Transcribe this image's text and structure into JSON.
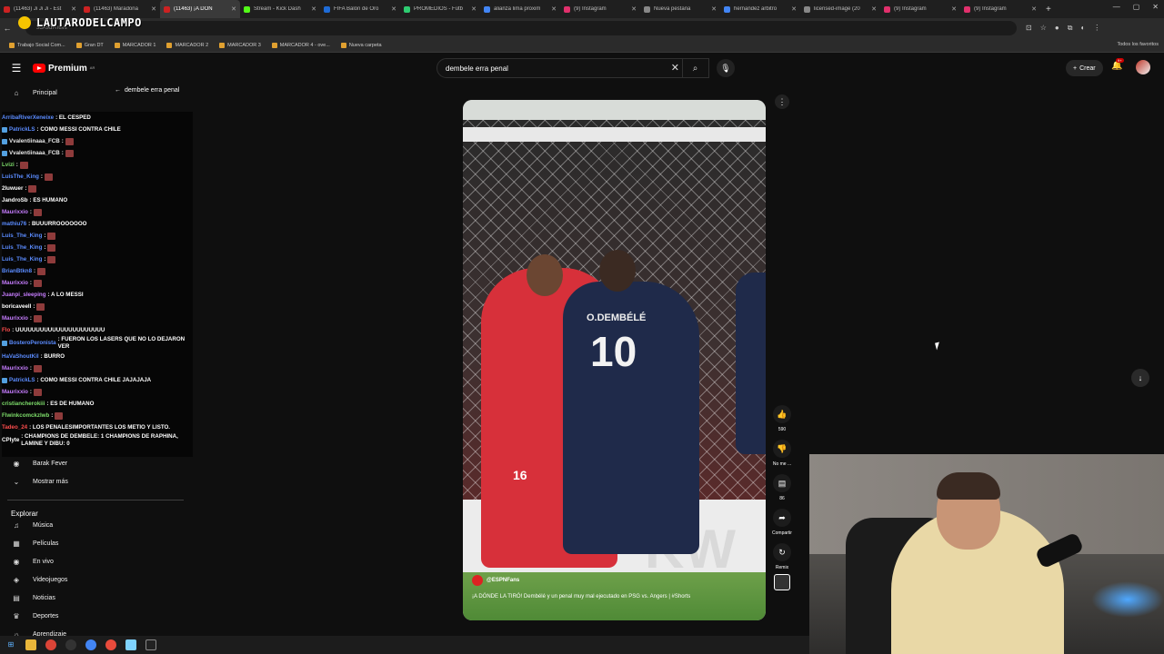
{
  "tabs": [
    {
      "label": "(11463) Ji Ji Ji - Est",
      "color": "#cc2222"
    },
    {
      "label": "(11463) Maradona",
      "color": "#cc2222"
    },
    {
      "label": "(11463) ¡A DÓN",
      "color": "#cc2222",
      "active": true
    },
    {
      "label": "Stream - Kick Dash",
      "color": "#53fc18"
    },
    {
      "label": "FIFA Balón de Oro",
      "color": "#1e6bd6"
    },
    {
      "label": "PROMEDIOS - Fútb",
      "color": "#2ecc71"
    },
    {
      "label": "alianza lima proxim",
      "color": "#4285f4"
    },
    {
      "label": "(9) Instagram",
      "color": "#e1306c"
    },
    {
      "label": "Nueva pestaña",
      "color": "#888888"
    },
    {
      "label": "hernandez arbitro",
      "color": "#4285f4"
    },
    {
      "label": "licensed-image (20",
      "color": "#888888"
    },
    {
      "label": "(9) Instagram",
      "color": "#e1306c"
    },
    {
      "label": "(9) Instagram",
      "color": "#e1306c"
    }
  ],
  "address": {
    "url": "",
    "caption": "3dA9dI-huvs"
  },
  "bookmarks": [
    "Trabajo Social Com...",
    "Gran DT",
    "MARCADOR 1",
    "MARCADOR 2",
    "MARCADOR 3",
    "MARCADOR 4 - ove...",
    "Nueva carpeta"
  ],
  "bookmarks_right": "Todos los favoritos",
  "streamer": {
    "name": "LAUTARODELCAMPO"
  },
  "header": {
    "logo_text": "Premium",
    "logo_sup": "AR",
    "search_value": "dembele erra penal",
    "create_label": "Crear",
    "notif_badge": "9+"
  },
  "sidebar": {
    "back_label": "dembele erra penal",
    "items": [
      {
        "label": "Principal",
        "icon": "home-icon",
        "glyph": "⌂"
      }
    ],
    "footer_items": [
      {
        "label": "Barak Fever",
        "icon": "channel-avatar",
        "glyph": "◉"
      },
      {
        "label": "Mostrar más",
        "icon": "chevron-down-icon",
        "glyph": "⌄"
      }
    ],
    "explore_title": "Explorar",
    "explore_items": [
      {
        "label": "Música",
        "icon": "music-icon",
        "glyph": "♫"
      },
      {
        "label": "Películas",
        "icon": "film-icon",
        "glyph": "▦"
      },
      {
        "label": "En vivo",
        "icon": "live-icon",
        "glyph": "◉"
      },
      {
        "label": "Videojuegos",
        "icon": "gamepad-icon",
        "glyph": "◈"
      },
      {
        "label": "Noticias",
        "icon": "news-icon",
        "glyph": "▤"
      },
      {
        "label": "Deportes",
        "icon": "trophy-icon",
        "glyph": "♛"
      },
      {
        "label": "Aprendizaje",
        "icon": "lightbulb-icon",
        "glyph": "☼"
      }
    ]
  },
  "chat": [
    {
      "user": "ArribaRiverXeneixe",
      "color": "#5b8cff",
      "msg": ": EL CESPED"
    },
    {
      "user": "PatrickLS",
      "color": "#5b8cff",
      "msg": ": COMO MESSI CONTRA CHILE",
      "badge": true
    },
    {
      "user": "Vvalentiinaaa_FCB",
      "color": "#e8e8e8",
      "msg": ":",
      "badge": true,
      "emote": true
    },
    {
      "user": "Vvalentiinaaa_FCB",
      "color": "#e8e8e8",
      "msg": ":",
      "badge": true,
      "emote": true
    },
    {
      "user": "Lvizi",
      "color": "#7ddc6a",
      "msg": ":",
      "emote": true
    },
    {
      "user": "LuisThe_King",
      "color": "#5b8cff",
      "msg": ":",
      "emote": true
    },
    {
      "user": "2luwuer",
      "color": "#ffffff",
      "msg": ":",
      "emote": true
    },
    {
      "user": "JandroSb",
      "color": "#ffffff",
      "msg": ": ES HUMANO"
    },
    {
      "user": "Maurixxio",
      "color": "#c77dff",
      "msg": ":",
      "emote": true
    },
    {
      "user": "mathiu76",
      "color": "#5b8cff",
      "msg": ": BUUURROOOOOOO"
    },
    {
      "user": "Luis_The_King",
      "color": "#5b8cff",
      "msg": ":",
      "emote": true
    },
    {
      "user": "Luis_The_King",
      "color": "#5b8cff",
      "msg": ":",
      "emote": true
    },
    {
      "user": "Luis_The_King",
      "color": "#5b8cff",
      "msg": ":",
      "emote": true
    },
    {
      "user": "BrianBtkn8",
      "color": "#5b8cff",
      "msg": ":",
      "emote": true
    },
    {
      "user": "Maurixxio",
      "color": "#c77dff",
      "msg": ":",
      "emote": true
    },
    {
      "user": "Juanpi_sleeping",
      "color": "#c77dff",
      "msg": ": A LO MESSI"
    },
    {
      "user": "boricaveell",
      "color": "#ffffff",
      "msg": ":",
      "emote": true
    },
    {
      "user": "Maurixxio",
      "color": "#c77dff",
      "msg": ":",
      "emote": true
    },
    {
      "user": "Flo",
      "color": "#ff4d4d",
      "msg": ": UUUUUUUUUUUUUUUUUUUUUU"
    },
    {
      "user": "BosteroPeronista",
      "color": "#5b8cff",
      "msg": ": FUERON LOS LASERS QUE NO LO DEJARON VER",
      "badge": true,
      "wrap": true
    },
    {
      "user": "HaVaShoutKil",
      "color": "#5b8cff",
      "msg": ": BURRO"
    },
    {
      "user": "Maurixxio",
      "color": "#c77dff",
      "msg": ":",
      "emote": true
    },
    {
      "user": "PatrickLS",
      "color": "#5b8cff",
      "msg": ": COMO MESSI CONTRA CHILE JAJAJAJA",
      "badge": true
    },
    {
      "user": "Maurixxio",
      "color": "#c77dff",
      "msg": ":",
      "emote": true
    },
    {
      "user": "cristiancherokiii",
      "color": "#7ddc6a",
      "msg": ": ES DE HUMANO"
    },
    {
      "user": "Flwinkcomckzlwb",
      "color": "#7ddc6a",
      "msg": ":",
      "emote": true
    },
    {
      "user": "Tadeo_24",
      "color": "#ff4d4d",
      "msg": ": LOS PENALESIMPORTANTES LOS METIO Y LISTO."
    },
    {
      "user": "CPlyte",
      "color": "#ffffff",
      "msg": ": CHAMPIONS DE DEMBELE: 1 CHAMPIONS DE RAPHINA, LAMINE Y DIBU: 0",
      "wrap": true
    }
  ],
  "video": {
    "player_name": "O.DEMBÉLÉ",
    "player_number": "10",
    "keeper_number": "16",
    "ad_text": "KW",
    "channel": "@ESPNFans",
    "title": "¡A DÓNDE LA TIRÓ! Dembélé y un penal muy mal ejecutado en PSG vs. Angers | #Shorts"
  },
  "actions": {
    "like_count": "590",
    "dislike_label": "No me ...",
    "comments_count": "86",
    "share_label": "Compartir",
    "remix_label": "Remix"
  },
  "colors": {
    "accent": "#ff0000",
    "background": "#0f0f0f"
  }
}
